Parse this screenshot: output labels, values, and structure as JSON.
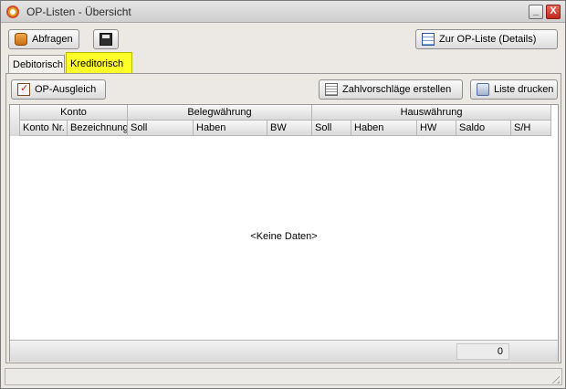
{
  "window": {
    "title": "OP-Listen - Übersicht"
  },
  "titlebar": {
    "min_symbol": "_",
    "close_symbol": "X"
  },
  "toolbar": {
    "abfragen_label": "Abfragen",
    "details_label": "Zur OP-Liste (Details)"
  },
  "tabs": [
    {
      "label": "Debitorisch",
      "active": false
    },
    {
      "label": "Kreditorisch",
      "active": true
    }
  ],
  "tab_highlight_color": "#ffff28",
  "panel_toolbar": {
    "op_ausgleich_label": "OP-Ausgleich",
    "zahlvorschlaege_label": "Zahlvorschläge erstellen",
    "liste_drucken_label": "Liste drucken"
  },
  "grid": {
    "bands": [
      "Konto",
      "Belegwährung",
      "Hauswährung"
    ],
    "columns": [
      "Konto Nr.",
      "Bezeichnung",
      "Soll",
      "Haben",
      "BW",
      "Soll",
      "Haben",
      "HW",
      "Saldo",
      "S/H"
    ],
    "empty_text": "<Keine Daten>",
    "footer_count": "0"
  },
  "icons": {
    "app": "app-icon",
    "abfragen": "database-icon",
    "save": "save-icon",
    "details": "grid-icon",
    "op_ausgleich": "clipboard-check-icon",
    "zahlvorschlaege": "document-icon",
    "drucken": "printer-icon"
  }
}
